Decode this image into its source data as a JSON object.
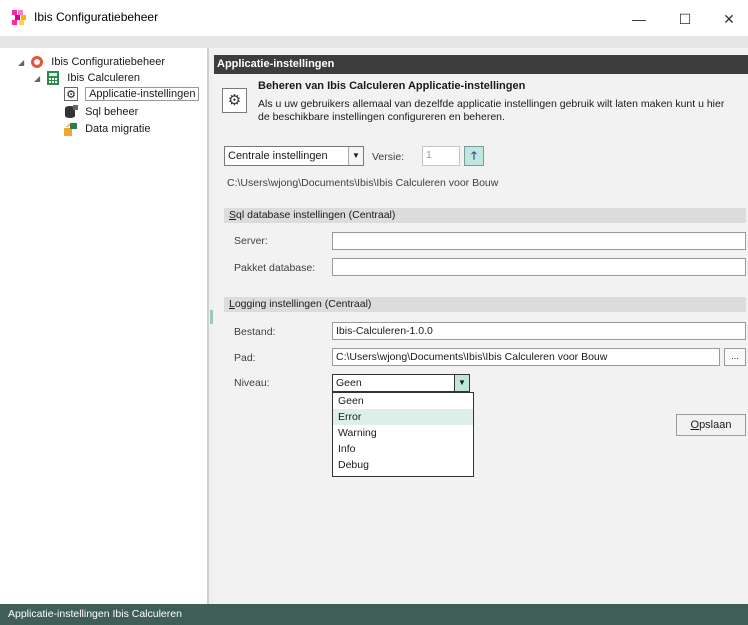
{
  "window": {
    "title": "Ibis Configuratiebeheer",
    "minimize": "—",
    "maximize": "☐",
    "close": "✕"
  },
  "tree": {
    "root": "Ibis Configuratiebeheer",
    "child": "Ibis Calculeren",
    "items": [
      {
        "label": "Applicatie-instellingen",
        "icon": "gear-icon"
      },
      {
        "label": "Sql beheer",
        "icon": "database-icon"
      },
      {
        "label": "Data migratie",
        "icon": "migration-icon"
      }
    ]
  },
  "panel": {
    "header": "Applicatie-instellingen",
    "headline": "Beheren van Ibis Calculeren Applicatie-instellingen",
    "description": "Als u uw gebruikers allemaal van dezelfde applicatie instellingen gebruik wilt laten maken kunt u hier de beschikbare instellingen configureren en beheren.",
    "mode": "Centrale instellingen",
    "version_label": "Versie:",
    "version_value": "1",
    "path_text": "C:\\Users\\wjong\\Documents\\Ibis\\Ibis Calculeren voor Bouw"
  },
  "sql_section": {
    "title_first": "S",
    "title_rest": "ql database instellingen  (Centraal)",
    "server_label": "Server:",
    "server_value": "",
    "package_label": "Pakket database:",
    "package_value": ""
  },
  "logging_section": {
    "title_first": "L",
    "title_rest": "ogging instellingen  (Centraal)",
    "file_label": "Bestand:",
    "file_value": "Ibis-Calculeren-1.0.0",
    "path_label": "Pad:",
    "path_value": "C:\\Users\\wjong\\Documents\\Ibis\\Ibis Calculeren voor Bouw",
    "browse": "...",
    "level_label": "Niveau:",
    "level_value": "Geen",
    "level_options": [
      "Geen",
      "Error",
      "Warning",
      "Info",
      "Debug"
    ],
    "highlighted_option": "Error"
  },
  "save": {
    "first": "O",
    "rest": "pslaan"
  },
  "status": "Applicatie-instellingen Ibis Calculeren",
  "colors": {
    "header": "#3d3d3d",
    "statusbar": "#3e5e57",
    "highlight": "#dcefea",
    "arrow_button": "#bfe6df"
  }
}
